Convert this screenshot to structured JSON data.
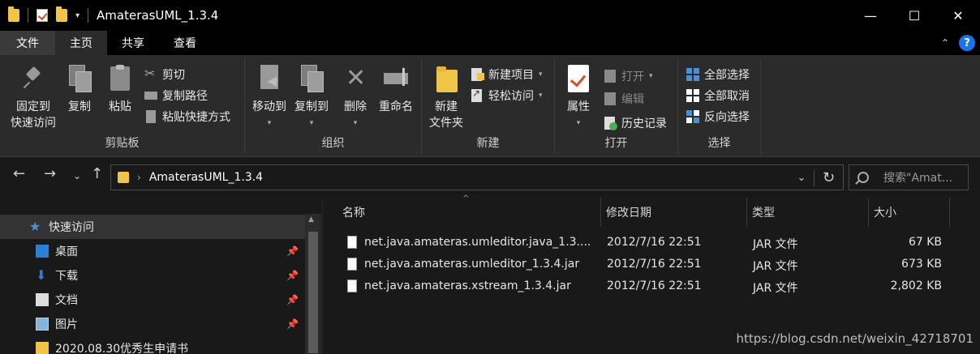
{
  "window": {
    "title": "AmaterasUML_1.3.4",
    "minimize": "—",
    "maximize": "☐",
    "close": "✕"
  },
  "tabs": [
    {
      "label": "文件"
    },
    {
      "label": "主页"
    },
    {
      "label": "共享"
    },
    {
      "label": "查看"
    }
  ],
  "ribbon": {
    "clipboard": {
      "pin_line1": "固定到",
      "pin_line2": "快速访问",
      "copy": "复制",
      "paste": "粘贴",
      "cut": "剪切",
      "copy_path": "复制路径",
      "paste_shortcut": "粘贴快捷方式",
      "label": "剪贴板"
    },
    "organize": {
      "move_to": "移动到",
      "copy_to": "复制到",
      "delete": "删除",
      "rename": "重命名",
      "label": "组织"
    },
    "new": {
      "new_folder_line1": "新建",
      "new_folder_line2": "文件夹",
      "new_item": "新建项目",
      "easy_access": "轻松访问",
      "label": "新建"
    },
    "open": {
      "properties": "属性",
      "open": "打开",
      "edit": "编辑",
      "history": "历史记录",
      "label": "打开"
    },
    "select": {
      "select_all": "全部选择",
      "select_none": "全部取消",
      "invert": "反向选择",
      "label": "选择"
    }
  },
  "address": {
    "path": "AmaterasUML_1.3.4",
    "search_placeholder": "搜索\"Amat..."
  },
  "sidebar": {
    "items": [
      {
        "label": "快速访问",
        "icon": "star-icon"
      },
      {
        "label": "桌面",
        "icon": "desktop-icon",
        "pinned": true
      },
      {
        "label": "下载",
        "icon": "download-icon",
        "pinned": true
      },
      {
        "label": "文档",
        "icon": "document-icon",
        "pinned": true
      },
      {
        "label": "图片",
        "icon": "pictures-icon",
        "pinned": true
      },
      {
        "label": "2020.08.30优秀生申请书",
        "icon": "folder-icon"
      }
    ]
  },
  "columns": {
    "name": "名称",
    "modified": "修改日期",
    "type": "类型",
    "size": "大小"
  },
  "files": [
    {
      "name": "net.java.amateras.umleditor.java_1.3....",
      "modified": "2012/7/16 22:51",
      "type": "JAR 文件",
      "size": "67 KB"
    },
    {
      "name": "net.java.amateras.umleditor_1.3.4.jar",
      "modified": "2012/7/16 22:51",
      "type": "JAR 文件",
      "size": "673 KB"
    },
    {
      "name": "net.java.amateras.xstream_1.3.4.jar",
      "modified": "2012/7/16 22:51",
      "type": "JAR 文件",
      "size": "2,802 KB"
    }
  ],
  "watermark": "https://blog.csdn.net/weixin_42718701",
  "colors": {
    "background": "#191919",
    "ribbon": "#2b2b2b",
    "accent": "#4a90d9",
    "folder": "#f0c449"
  }
}
